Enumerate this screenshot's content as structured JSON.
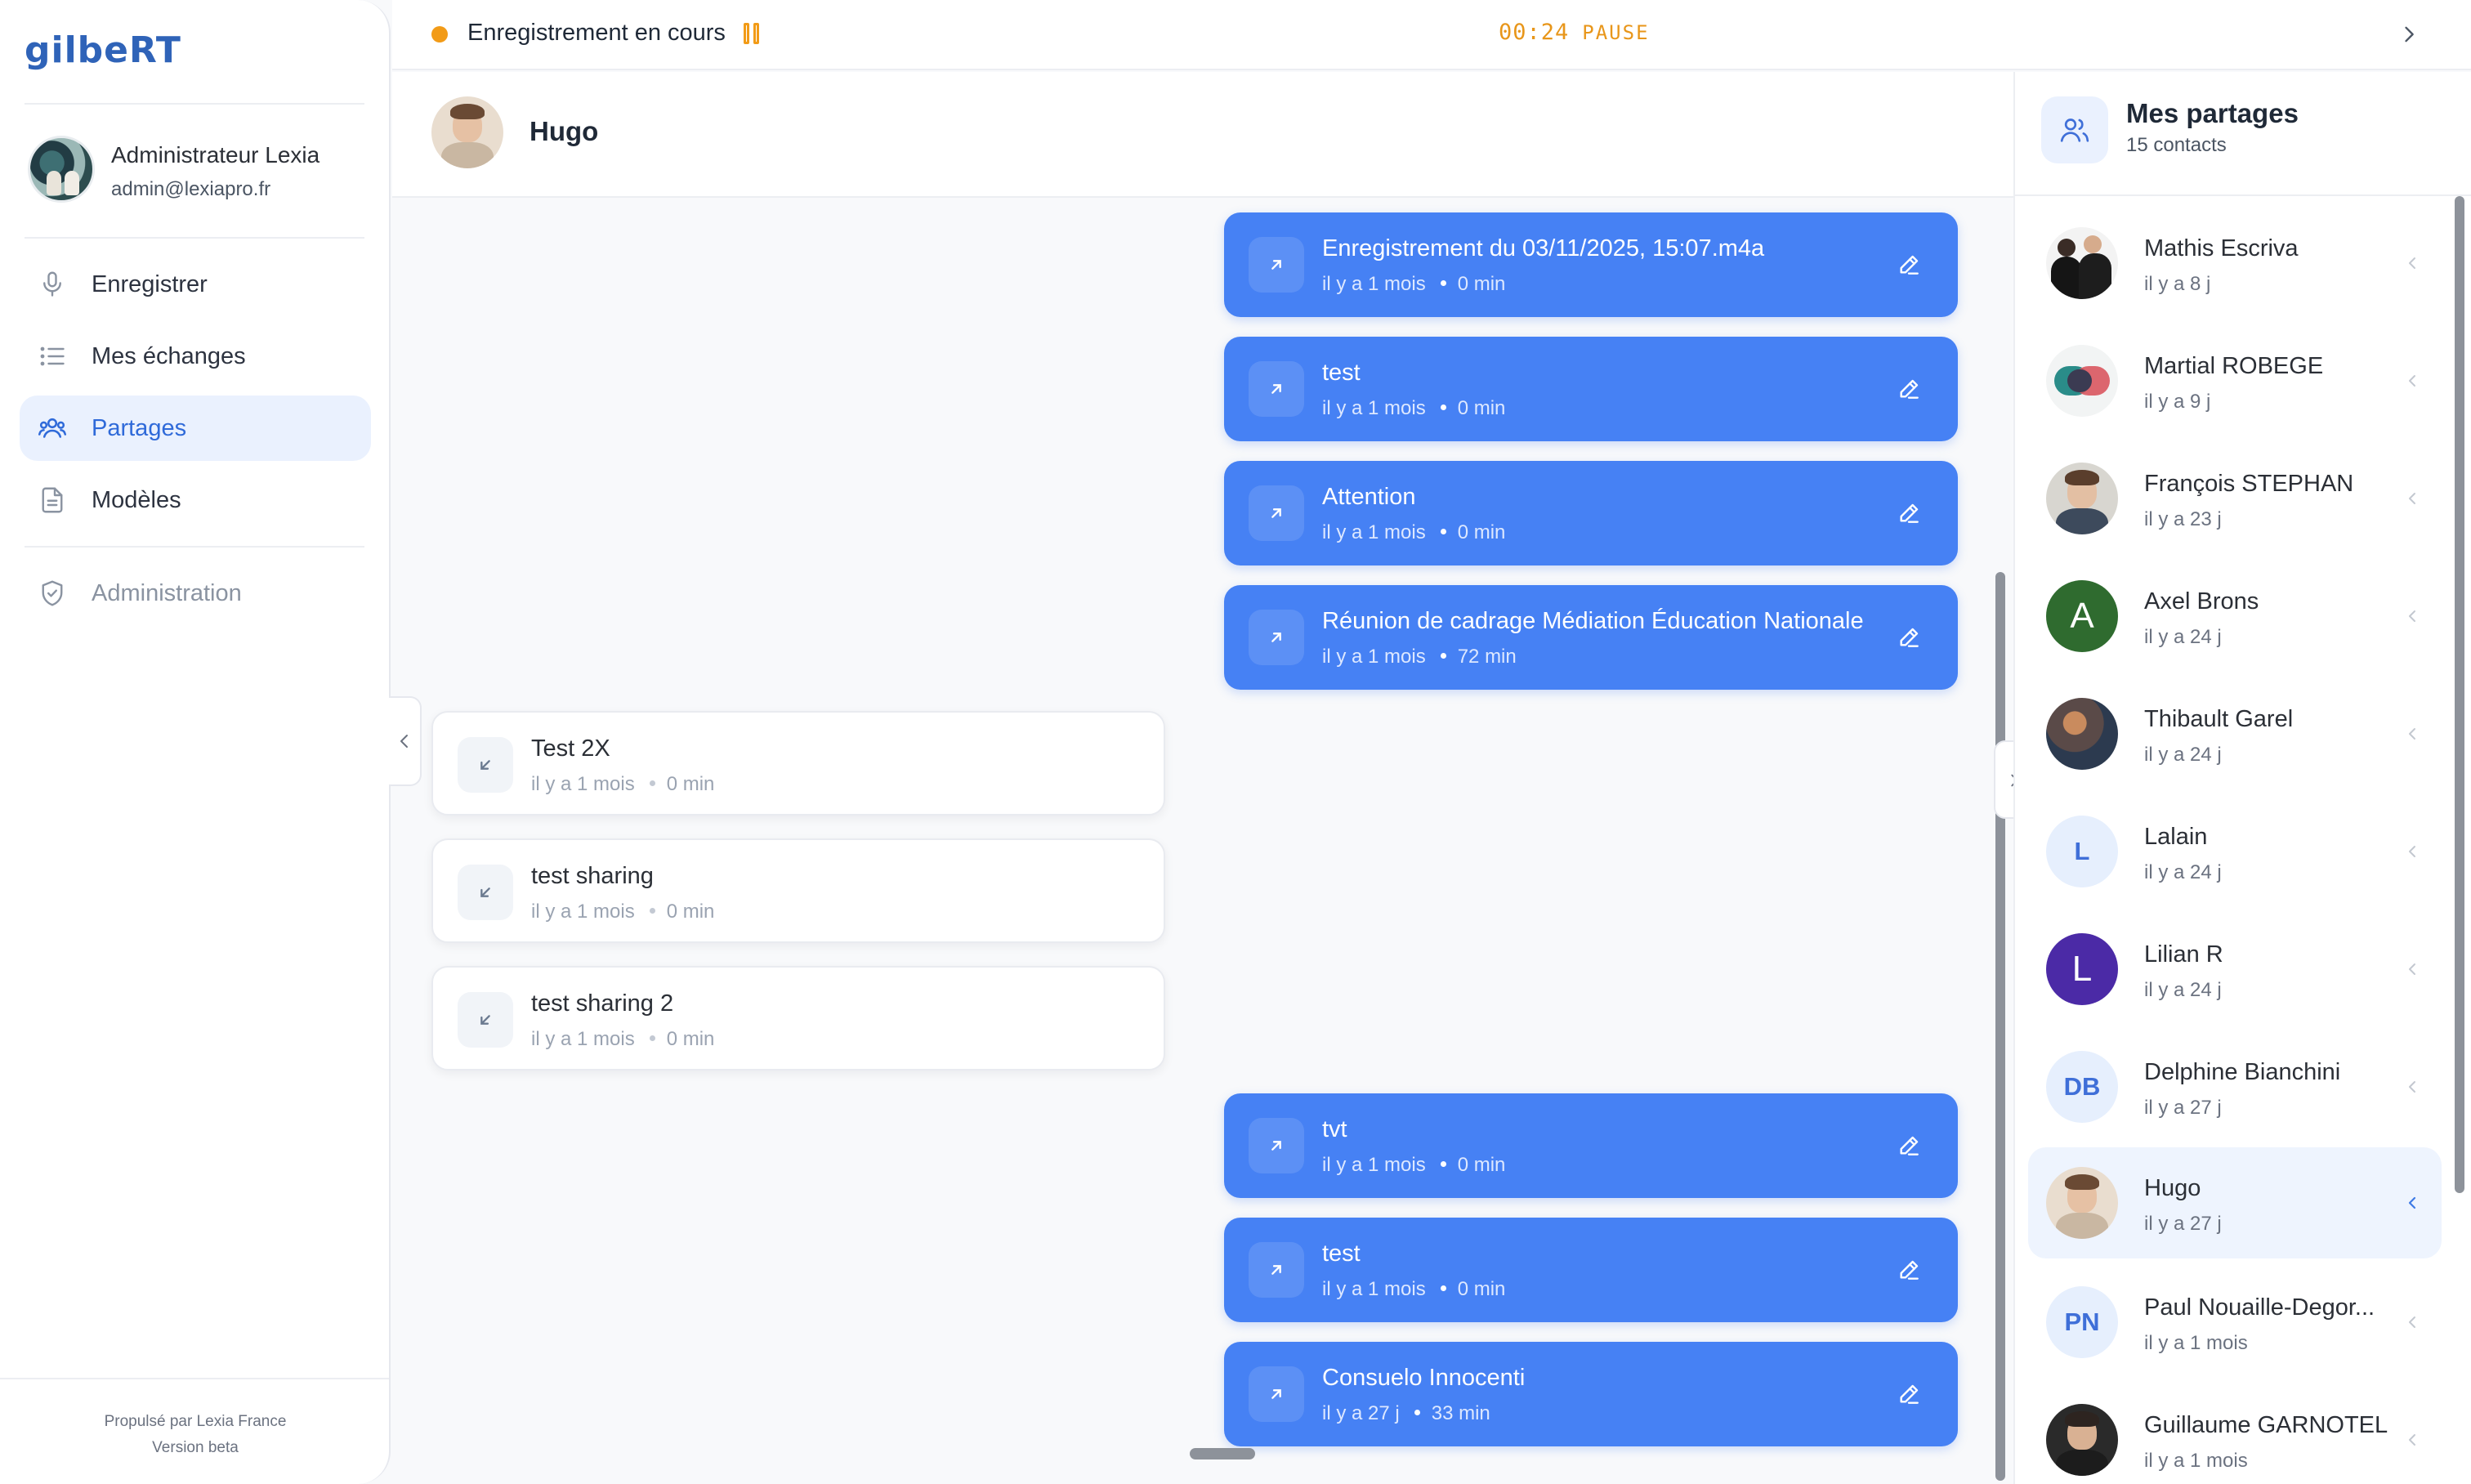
{
  "app": {
    "logo": "gilbeRT",
    "user_name": "Administrateur Lexia",
    "user_email": "admin@lexiapro.fr"
  },
  "nav": [
    {
      "label": "Enregistrer",
      "icon": "microphone-icon",
      "active": false
    },
    {
      "label": "Mes échanges",
      "icon": "list-icon",
      "active": false
    },
    {
      "label": "Partages",
      "icon": "users-icon",
      "active": true
    },
    {
      "label": "Modèles",
      "icon": "document-icon",
      "active": false
    },
    {
      "label": "Administration",
      "icon": "shield-icon",
      "active": false
    }
  ],
  "footer": {
    "powered": "Propulsé par Lexia France",
    "version": "Version beta"
  },
  "recording": {
    "status": "Enregistrement en cours",
    "timer": "00:24",
    "state": "PAUSE"
  },
  "conversation": {
    "contact_name": "Hugo",
    "messages": [
      {
        "direction": "out",
        "title": "Enregistrement du 03/11/2025, 15:07.m4a",
        "when": "il y a 1 mois",
        "duration": "0 min"
      },
      {
        "direction": "out",
        "title": "test",
        "when": "il y a 1 mois",
        "duration": "0 min"
      },
      {
        "direction": "out",
        "title": "Attention",
        "when": "il y a 1 mois",
        "duration": "0 min"
      },
      {
        "direction": "out",
        "title": "Réunion de cadrage Médiation Éducation Nationale",
        "when": "il y a 1 mois",
        "duration": "72 min"
      },
      {
        "direction": "in",
        "title": "Test 2X",
        "when": "il y a 1 mois",
        "duration": "0 min"
      },
      {
        "direction": "in",
        "title": "test sharing",
        "when": "il y a 1 mois",
        "duration": "0 min"
      },
      {
        "direction": "in",
        "title": "test sharing 2",
        "when": "il y a 1 mois",
        "duration": "0 min"
      },
      {
        "direction": "out",
        "title": "tvt",
        "when": "il y a 1 mois",
        "duration": "0 min"
      },
      {
        "direction": "out",
        "title": "test",
        "when": "il y a 1 mois",
        "duration": "0 min"
      },
      {
        "direction": "out",
        "title": "Consuelo Innocenti",
        "when": "il y a 27 j",
        "duration": "33 min"
      }
    ]
  },
  "shares": {
    "title": "Mes partages",
    "count_label": "15 contacts",
    "contacts": [
      {
        "name": "Mathis Escriva",
        "when": "il y a 8 j",
        "avatar": "photo"
      },
      {
        "name": "Martial ROBEGE",
        "when": "il y a 9 j",
        "avatar": "logo"
      },
      {
        "name": "François STEPHAN",
        "when": "il y a 23 j",
        "avatar": "photo"
      },
      {
        "name": "Axel Brons",
        "when": "il y a 24 j",
        "avatar": "A"
      },
      {
        "name": "Thibault Garel",
        "when": "il y a 24 j",
        "avatar": "photo"
      },
      {
        "name": "Lalain",
        "when": "il y a 24 j",
        "avatar": "L"
      },
      {
        "name": "Lilian R",
        "when": "il y a 24 j",
        "avatar": "L"
      },
      {
        "name": "Delphine Bianchini",
        "when": "il y a 27 j",
        "avatar": "DB"
      },
      {
        "name": "Hugo",
        "when": "il y a 27 j",
        "avatar": "photo",
        "active": true
      },
      {
        "name": "Paul Nouaille-Degor...",
        "when": "il y a 1 mois",
        "avatar": "PN"
      },
      {
        "name": "Guillaume GARNOTEL",
        "when": "il y a 1 mois",
        "avatar": "photo"
      }
    ]
  },
  "colors": {
    "accent": "#4681f4",
    "recording": "#f29b17",
    "active_nav_bg": "#eaf1fe"
  }
}
